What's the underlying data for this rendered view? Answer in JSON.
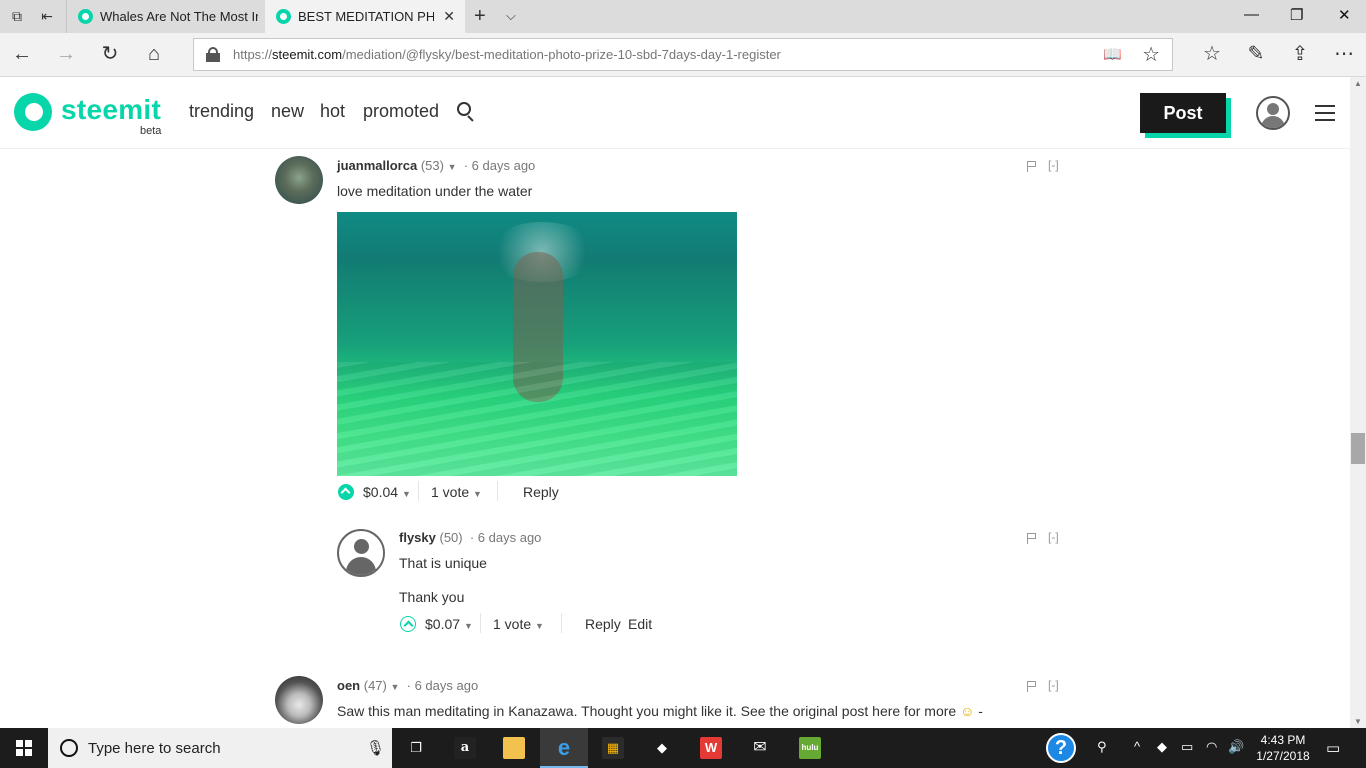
{
  "browser": {
    "tabs": [
      {
        "title": "Whales Are Not The Most Ir"
      },
      {
        "title": "BEST MEDITATION PHO"
      }
    ],
    "url": {
      "scheme": "https://",
      "host": "steemit.com",
      "path": "/mediation/@flysky/best-meditation-photo-prize-10-sbd-7days-day-1-register"
    }
  },
  "site": {
    "logo_text": "steemit",
    "logo_sub": "beta",
    "nav": [
      "trending",
      "new",
      "hot",
      "promoted"
    ],
    "post_label": "Post",
    "accent": "#06d6a9"
  },
  "comments": [
    {
      "author": "juanmallorca",
      "rep": "(53)",
      "time": "6 days ago",
      "text": "love meditation under the water",
      "payout": "$0.04",
      "votes": "1 vote",
      "reply": "Reply",
      "collapse": "[-]"
    },
    {
      "author": "flysky",
      "rep": "(50)",
      "time": "6 days ago",
      "text": "That is unique",
      "text2": "Thank you",
      "payout": "$0.07",
      "votes": "1 vote",
      "reply": "Reply",
      "edit": "Edit",
      "collapse": "[-]"
    },
    {
      "author": "oen",
      "rep": "(47)",
      "time": "6 days ago",
      "text": "Saw this man meditating in Kanazawa. Thought you might like it. See the original post here for more",
      "text_tail": "-",
      "collapse": "[-]"
    }
  ],
  "taskbar": {
    "search_placeholder": "Type here to search",
    "time": "4:43 PM",
    "date": "1/27/2018",
    "amazon_label": "a",
    "hulu_label": "hulu"
  }
}
